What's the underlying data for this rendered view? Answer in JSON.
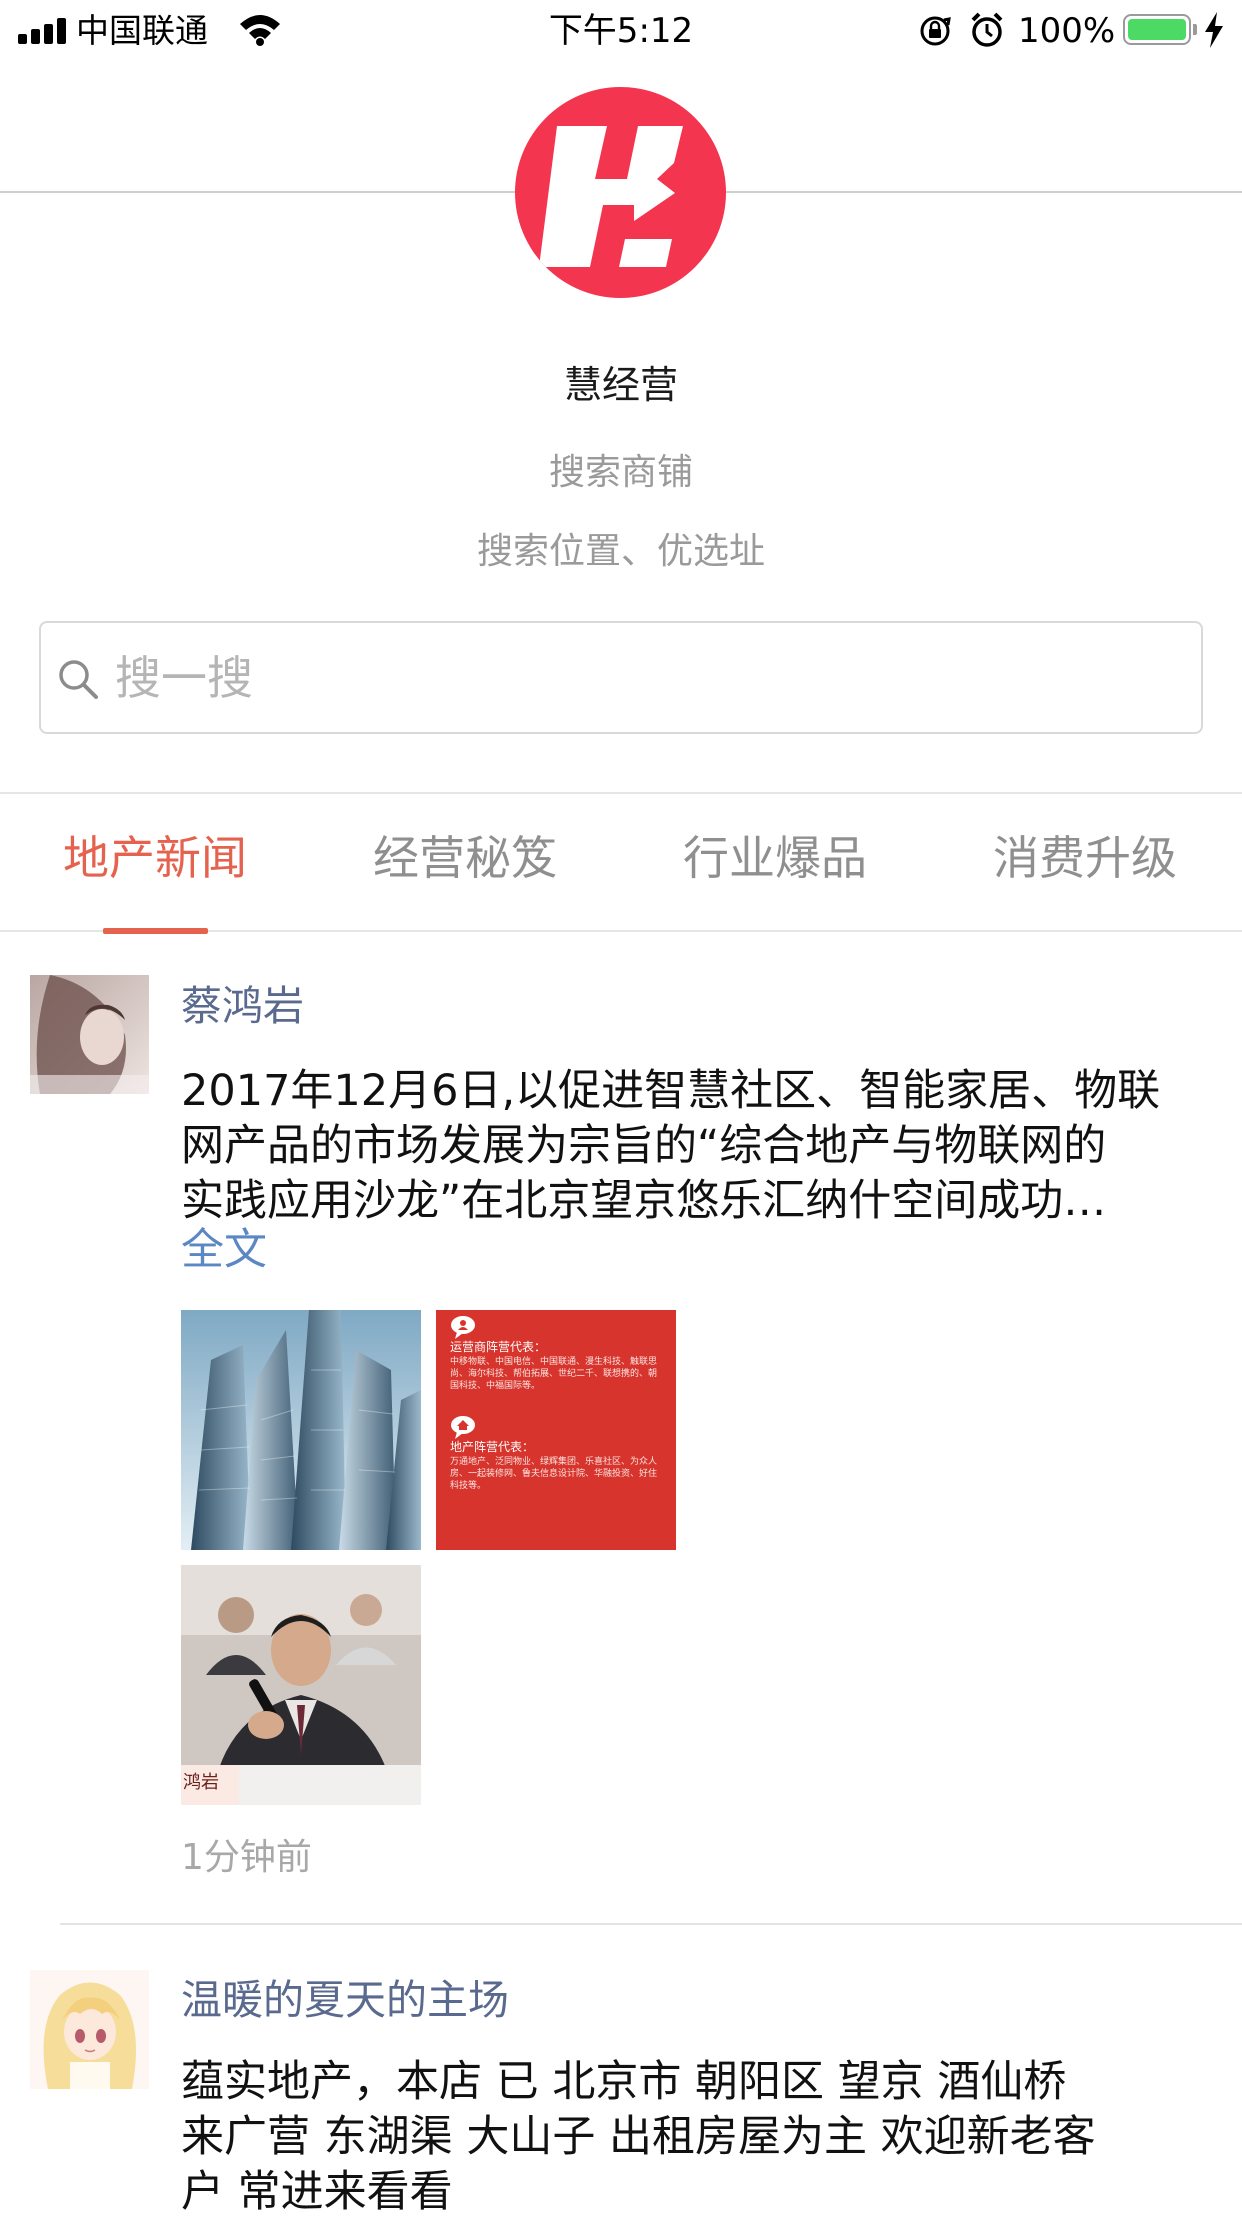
{
  "status_bar": {
    "carrier": "中国联通",
    "time": "下午5:12",
    "battery": "100%",
    "battery_level": 1.0,
    "battery_color": "#4cd964"
  },
  "header": {
    "logo": "慧经营 logo",
    "app_name": "慧经营",
    "subtitle_1": "搜索商铺",
    "subtitle_2": "搜索位置、优选址",
    "brand_color": "#f4354f"
  },
  "search": {
    "placeholder": "搜一搜"
  },
  "tabs": [
    {
      "label": "地产新闻",
      "active": true
    },
    {
      "label": "经营秘笈",
      "active": false
    },
    {
      "label": "行业爆品",
      "active": false
    },
    {
      "label": "消费升级",
      "active": false
    }
  ],
  "accent_color": "#e4624e",
  "posts": [
    {
      "author": "蔡鸿岩",
      "avatar_icon": "girl-photo-avatar",
      "lines": [
        "2017年12月6日,以促进智慧社区、智能家居、物联",
        "网产品的市场发展为宗旨的“综合地产与物联网的",
        "实践应用沙龙”在北京望京悠乐汇纳什空间成功…"
      ],
      "full_text_label": "全文",
      "images": [
        {
          "kind": "skyscrapers-photo"
        },
        {
          "kind": "red-poster",
          "heading_1": "运营商阵营代表：",
          "body_1": "中移物联、中国电信、中国联通、漫生科技、触联思尚、海尔科技、帮伯拓展、世纪二千、联想携的、朝国科技、中福国际等。",
          "heading_2": "地产阵营代表：",
          "body_2": "万通地产、泛同物业、绿辉集团、乐喜社区、为众人房、一起装修网、鲁夫信息设计院、华融投资、好住科技等。"
        },
        {
          "kind": "speaker-photo",
          "caption": "鸿岩"
        }
      ],
      "time": "1分钟前"
    },
    {
      "author": "温暖的夏天的主场",
      "avatar_icon": "anime-girl-avatar",
      "lines": [
        "蕴实地产，本店  已 北京市  朝阳区   望京  酒仙桥",
        "来广营  东湖渠  大山子 出租房屋为主  欢迎新老客",
        "户 常进来看看"
      ]
    }
  ]
}
